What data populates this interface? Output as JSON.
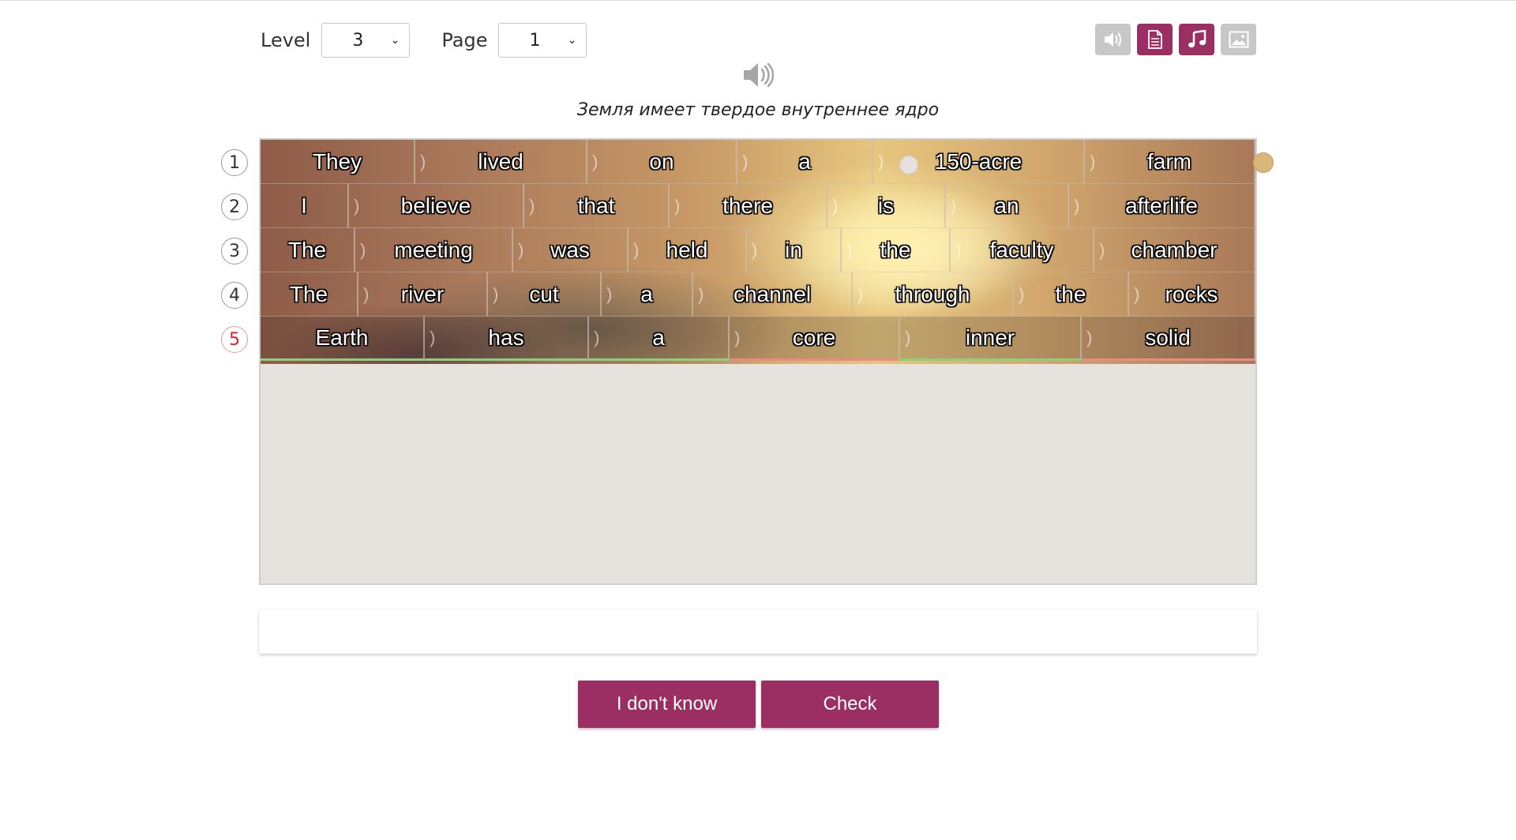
{
  "controls": {
    "level_label": "Level",
    "level_value": "3",
    "page_label": "Page",
    "page_value": "1"
  },
  "toolbar": [
    {
      "name": "sound-toggle-icon",
      "state": "off"
    },
    {
      "name": "document-icon",
      "state": "on"
    },
    {
      "name": "music-note-icon",
      "state": "on"
    },
    {
      "name": "image-icon",
      "state": "off"
    }
  ],
  "translation": "Земля имеет твердое внутреннее ядро",
  "lines": [
    {
      "number": "1",
      "words": [
        "They",
        "lived",
        "on",
        "a",
        "150-acre",
        "farm"
      ]
    },
    {
      "number": "2",
      "words": [
        "I",
        "believe",
        "that",
        "there",
        "is",
        "an",
        "afterlife"
      ]
    },
    {
      "number": "3",
      "words": [
        "The",
        "meeting",
        "was",
        "held",
        "in",
        "the",
        "faculty",
        "chamber"
      ]
    },
    {
      "number": "4",
      "words": [
        "The",
        "river",
        "cut",
        "a",
        "channel",
        "through",
        "the",
        "rocks"
      ]
    },
    {
      "number": "5",
      "words": [
        "Earth",
        "has",
        "a",
        "core",
        "inner",
        "solid"
      ],
      "current": true
    }
  ],
  "buttons": {
    "dont_know": "I don't know",
    "check": "Check"
  },
  "colors": {
    "accent": "#9b2e62",
    "correct": "#8ccf7e",
    "incorrect": "#e98a84"
  }
}
